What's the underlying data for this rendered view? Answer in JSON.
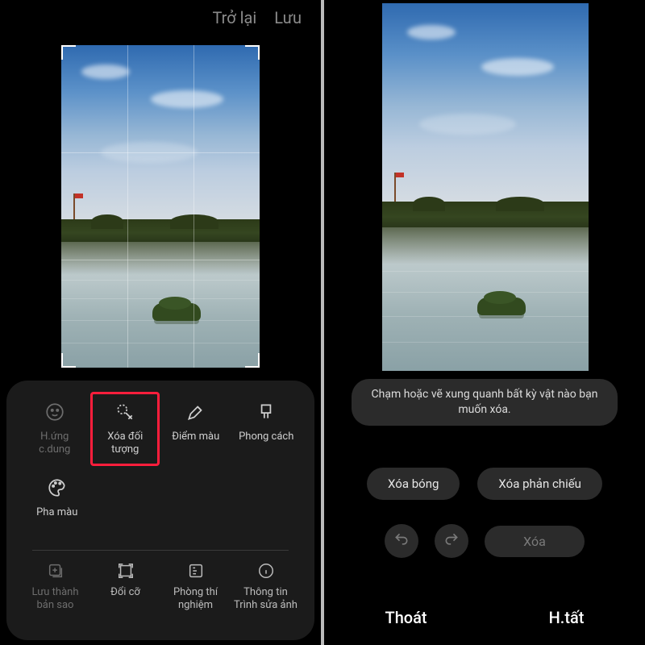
{
  "left": {
    "header": {
      "back": "Trở lại",
      "save": "Lưu"
    },
    "tools": {
      "portrait": {
        "label": "H.ứng c.dung",
        "icon": "face-icon"
      },
      "erase": {
        "label": "Xóa đối tượng",
        "icon": "erase-icon"
      },
      "spotcolor": {
        "label": "Điểm màu",
        "icon": "eyedropper-icon"
      },
      "style": {
        "label": "Phong cách",
        "icon": "brush-icon"
      },
      "colormix": {
        "label": "Pha màu",
        "icon": "palette-icon"
      }
    },
    "bottom": {
      "savecopy": {
        "label": "Lưu thành bản sao",
        "icon": "save-copy-icon"
      },
      "resize": {
        "label": "Đổi cỡ",
        "icon": "resize-icon"
      },
      "lab": {
        "label": "Phòng thí nghiệm",
        "icon": "lab-icon"
      },
      "info": {
        "label": "Thông tin Trình sửa ảnh",
        "icon": "info-icon"
      }
    }
  },
  "right": {
    "hint": "Chạm hoặc vẽ xung quanh bất kỳ vật nào bạn muốn xóa.",
    "btn_shadow": "Xóa bóng",
    "btn_reflection": "Xóa phản chiếu",
    "btn_erase": "Xóa",
    "footer": {
      "exit": "Thoát",
      "done": "H.tất"
    }
  }
}
